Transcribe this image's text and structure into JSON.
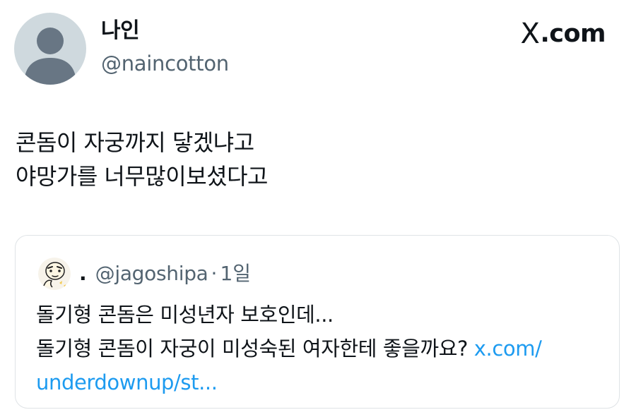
{
  "author": {
    "display_name": "나인",
    "handle": "@naincotton"
  },
  "brand": {
    "x_glyph": "X",
    "label": ".com"
  },
  "tweet": {
    "lines": [
      "콘돔이 자궁까지 닿겠냐고",
      "야망가를 너무많이보셨다고"
    ]
  },
  "quote": {
    "author_name": ".",
    "handle": "@jagoshipa",
    "separator": "·",
    "time": "1일",
    "line1": "돌기형 콘돔은 미성년자 보호인데...",
    "line2_text": "돌기형 콘돔이 자궁이 미성숙된 여자한테 좋을까요? ",
    "line2_link": "x.com/",
    "line3_link": "underdownup/st..."
  },
  "colors": {
    "link": "#1d9bf0",
    "secondary_text": "#536471",
    "avatar_bg": "#cfd9de",
    "avatar_fg": "#687684"
  },
  "icons": {
    "avatar": "default-profile-icon",
    "quote_avatar": "cartoon-face-icon",
    "brand": "x-logo-icon"
  }
}
